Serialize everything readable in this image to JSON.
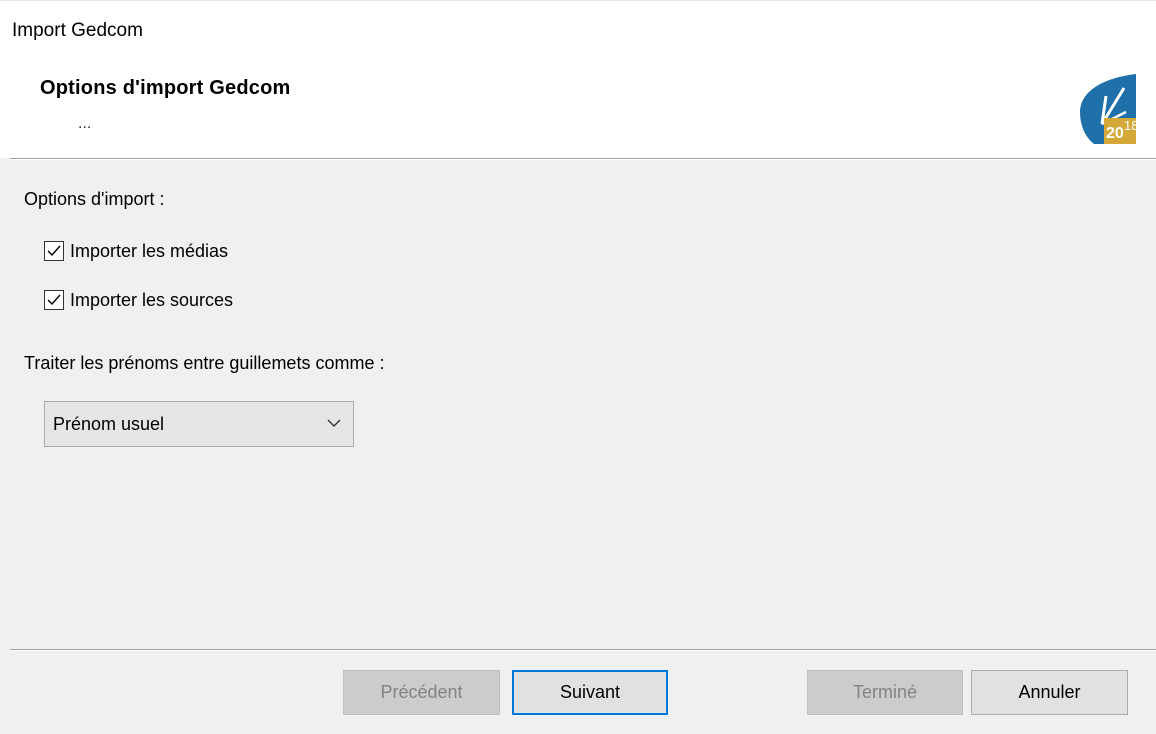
{
  "window": {
    "title": "Import Gedcom"
  },
  "header": {
    "title": "Options d'import Gedcom",
    "subtitle": "...",
    "logo_text": "2018"
  },
  "options": {
    "section_label": "Options d'import :",
    "import_media": {
      "label": "Importer les médias",
      "checked": true
    },
    "import_sources": {
      "label": "Importer les sources",
      "checked": true
    },
    "quoted_names_label": "Traiter les prénoms entre guillemets comme :",
    "quoted_names_select": {
      "value": "Prénom usuel"
    }
  },
  "footer": {
    "previous_label": "Précédent",
    "next_label": "Suivant",
    "finish_label": "Terminé",
    "cancel_label": "Annuler"
  },
  "colors": {
    "focus_border": "#0078d7",
    "logo_blue": "#1f6fa8",
    "logo_gold": "#d4a93a"
  }
}
